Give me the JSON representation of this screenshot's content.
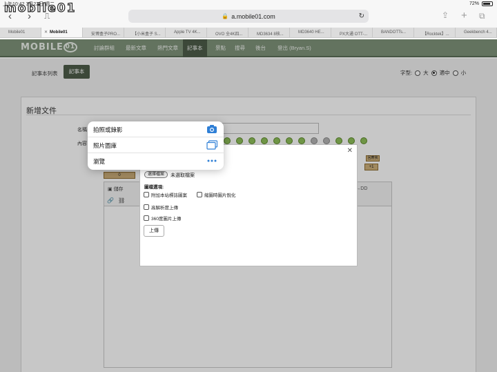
{
  "status": {
    "time": "上午10:42 3月22日 週二",
    "battery": "72%"
  },
  "watermark": "mobile01",
  "browser": {
    "url": "a.mobile01.com",
    "tabs": [
      {
        "label": "Mobile01"
      },
      {
        "label": "Mobile01"
      },
      {
        "label": "安博盒子PRO..."
      },
      {
        "label": "【小米盒子 S..."
      },
      {
        "label": "Apple TV 4K..."
      },
      {
        "label": "OVO 全4K四..."
      },
      {
        "label": "MD3634 8核..."
      },
      {
        "label": "MD3640 HE..."
      },
      {
        "label": "PX大通 OTT-..."
      },
      {
        "label": "BANDOTTs..."
      },
      {
        "label": "【Rocktek】..."
      },
      {
        "label": "Geekbench 4..."
      }
    ]
  },
  "site": {
    "logo": "MOBILE",
    "nav": [
      {
        "label": "討論群組"
      },
      {
        "label": "最新文章"
      },
      {
        "label": "熱門文章"
      },
      {
        "label": "記事本"
      },
      {
        "label": "景點"
      },
      {
        "label": "搜尋"
      },
      {
        "label": "後台"
      },
      {
        "label": "登出 (Bryan.S)"
      }
    ]
  },
  "notebook": {
    "list_tab": "記事本列表",
    "active_tab": "記事本",
    "font_label": "字型:",
    "font_options": [
      "大",
      "適中",
      "小"
    ],
    "font_selected": "適中"
  },
  "form": {
    "title": "新增文件",
    "name_label": "名稱",
    "content_label": "內容",
    "badge_a": "0",
    "badge_b": "+1",
    "badge_c": "回應我",
    "save_label": "儲存",
    "right_hint": "T↔DD"
  },
  "upload_dialog": {
    "choose_label": "選擇檔案",
    "no_file": "未選取檔案",
    "options_title": "圖檔選項:",
    "options": [
      "附加本站標誌圖案",
      "縮圖時圖片銳化",
      "高解析度上傳",
      "360度圖片上傳"
    ],
    "upload_label": "上傳"
  },
  "action_menu": {
    "items": [
      {
        "label": "拍照或錄影",
        "icon": "camera-icon"
      },
      {
        "label": "照片圖庫",
        "icon": "photo-library-icon"
      },
      {
        "label": "瀏覽",
        "icon": "more-icon"
      }
    ],
    "accent": "#2f7fd6"
  }
}
